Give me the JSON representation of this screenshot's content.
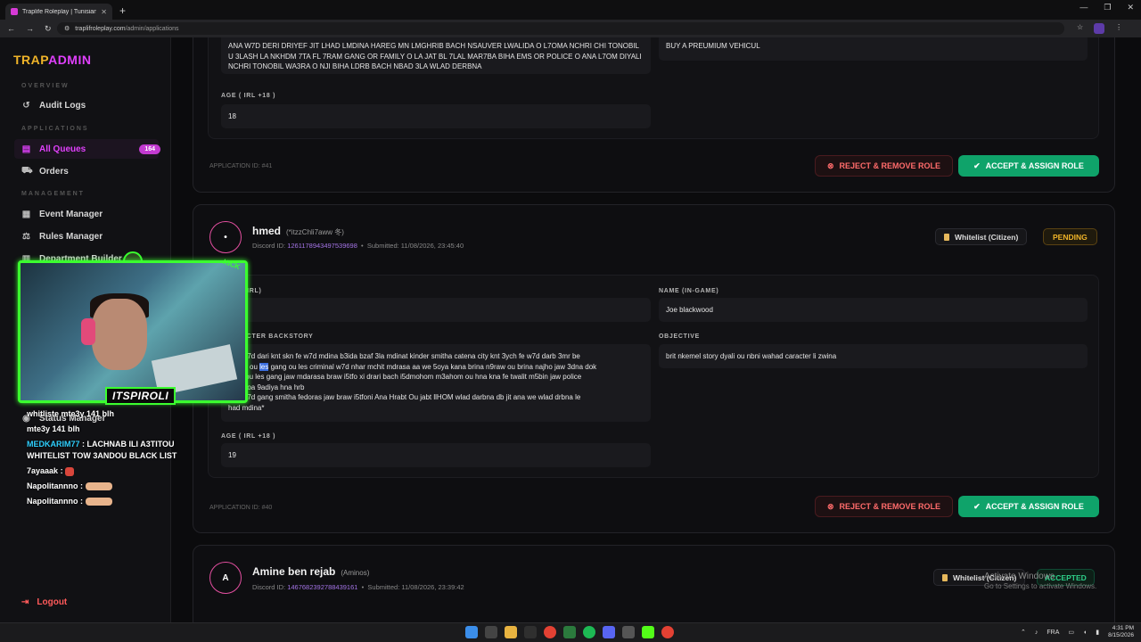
{
  "browser": {
    "tab_title": "Traplife Roleplay | Tunisian GTA",
    "url_domain": "traplifroleplay.com",
    "url_path": "/admin/applications"
  },
  "sidebar": {
    "brand_part1": "TRAP",
    "brand_part2": "ADMIN",
    "section_overview": "OVERVIEW",
    "audit_logs": "Audit Logs",
    "section_applications": "APPLICATIONS",
    "all_queues": "All Queues",
    "queue_count": "164",
    "orders": "Orders",
    "section_management": "MANAGEMENT",
    "event_manager": "Event Manager",
    "rules_manager": "Rules Manager",
    "department_builder": "Department Builder",
    "status_manager": "Status Manager",
    "logout": "Logout"
  },
  "app41": {
    "backstory_tail": "ANA W7D DERI DRIYEF JIT LHAD LMDINA HAREG MN LMGHRIB BACH NSAUVER LWALIDA O L7OMA NCHRI CHI TONOBIL U 3LASH LA NKHDM 7TA FL 7RAM GANG OR FAMILY O LA JAT BL 7LAL MAR7BA BIHA EMS OR POLICE O ANA L7OM DIYALI NCHRI TONOBIL WA3RA O NJI BIHA LDRB BACH NBAD 3LA WLAD DERBNA",
    "objective_tail": "BUY A PREUMIUM VEHICUL",
    "age_label": "AGE ( IRL +18 )",
    "age": "18",
    "app_id": "APPLICATION ID: #41",
    "reject": "REJECT & REMOVE ROLE",
    "accept": "ACCEPT & ASSIGN ROLE"
  },
  "app40": {
    "avatar": "•",
    "name": "hmed",
    "alias": "(*itzzChli7aww 冬)",
    "discord_label": "Discord ID:",
    "discord_id": "1261178943497539698",
    "submitted": "Submitted: 11/08/2026, 23:45:40",
    "whitelist": "Whitelist (Citizen)",
    "status": "PENDING",
    "name_irl_label": "NAME (IRL)",
    "name_game_label": "NAME (IN-GAME)",
    "name_game": "Joe blackwood",
    "backstory_label": "CHARACTER BACKSTORY",
    "backstory_l1": "ana w7d dari knt skn fe w7d mdina b3ida bzaf 3la mdinat kinder smitha catena city knt 3ych fe w7d darb 3mr be",
    "backstory_l2a": "gangs ou ",
    "backstory_l2hl": "les",
    "backstory_l2b": " gang ou les criminal w7d nhar mchit mdrasa aa we 5oya kana brina n9raw ou brina najho jaw 3dna dok",
    "backstory_l3": "nass ou les gang jaw mdarasa braw i5tfo xi drari bach i5dmohom m3ahom ou hna kna fe twalit m5bin jaw police",
    "backstory_l4": "ou i9tloa 9adiya hna hrb",
    "backstory_l5": "ana w7d gang smitha fedoras jaw braw i5tfoni Ana Hrabt Ou jabt llHOM wlad darbna db jit ana we wlad drbna le",
    "backstory_l6": "had mdina*",
    "objective_label": "OBJECTIVE",
    "objective": "brit nkemel story dyali ou nbni wahad caracter li zwina",
    "age_label": "AGE ( IRL +18 )",
    "age": "19",
    "app_id": "APPLICATION ID: #40",
    "reject": "REJECT & REMOVE ROLE",
    "accept": "ACCEPT & ASSIGN ROLE"
  },
  "app39": {
    "avatar": "A",
    "name": "Amine ben rejab",
    "alias": "(Aminos)",
    "discord_label": "Discord ID:",
    "discord_id": "1467682392788439161",
    "submitted": "Submitted: 11/08/2026, 23:39:42",
    "whitelist": "Whitelist (Citizen)",
    "status": "ACCEPTED"
  },
  "windows_activation": {
    "line1": "Activate Windows",
    "line2": "Go to Settings to activate Windows."
  },
  "stream": {
    "streamer": "ITSPIROLI",
    "kick": "KICK",
    "chat": [
      {
        "user": "",
        "text": "whitliste mte3y 141 blh"
      },
      {
        "user": "",
        "text": "mte3y 141 blh"
      },
      {
        "user": "MEDKARIM77",
        "text": ": LACHNAB ILI A3TITOU WHITELIST TOW 3ANDOU BLACK LIST"
      },
      {
        "user": "7ayaaak",
        "text": ":"
      },
      {
        "user": "Napolitannno",
        "text": ":"
      },
      {
        "user": "Napolitannno",
        "text": ":"
      }
    ]
  },
  "taskbar": {
    "lang": "FRA",
    "time": "4:31 PM",
    "date": "8/15/2026"
  }
}
